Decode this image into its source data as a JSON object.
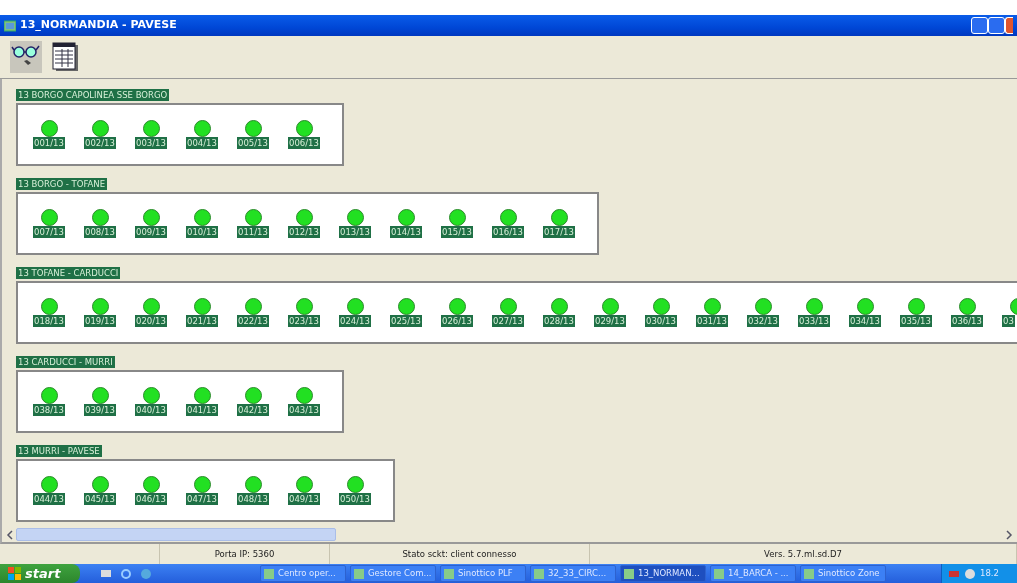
{
  "window": {
    "title": "13_NORMANDIA - PAVESE"
  },
  "groups": [
    {
      "name": "13 BORGO CAPOLINEA SSE BORGO",
      "devices": [
        {
          "label": "001/13",
          "active": true
        },
        {
          "label": "002/13",
          "active": true
        },
        {
          "label": "003/13",
          "active": true
        },
        {
          "label": "004/13",
          "active": true
        },
        {
          "label": "005/13",
          "active": true
        },
        {
          "label": "006/13",
          "active": true
        }
      ]
    },
    {
      "name": "13 BORGO - TOFANE",
      "devices": [
        {
          "label": "007/13",
          "active": true
        },
        {
          "label": "008/13",
          "active": true
        },
        {
          "label": "009/13",
          "active": true
        },
        {
          "label": "010/13",
          "active": true
        },
        {
          "label": "011/13",
          "active": true
        },
        {
          "label": "012/13",
          "active": true
        },
        {
          "label": "013/13",
          "active": true
        },
        {
          "label": "014/13",
          "active": true
        },
        {
          "label": "015/13",
          "active": true
        },
        {
          "label": "016/13",
          "active": true
        },
        {
          "label": "017/13",
          "active": true
        }
      ]
    },
    {
      "name": "13 TOFANE - CARDUCCI",
      "devices": [
        {
          "label": "018/13",
          "active": true
        },
        {
          "label": "019/13",
          "active": true
        },
        {
          "label": "020/13",
          "active": true
        },
        {
          "label": "021/13",
          "active": true
        },
        {
          "label": "022/13",
          "active": true
        },
        {
          "label": "023/13",
          "active": true
        },
        {
          "label": "024/13",
          "active": true
        },
        {
          "label": "025/13",
          "active": true
        },
        {
          "label": "026/13",
          "active": true
        },
        {
          "label": "027/13",
          "active": true
        },
        {
          "label": "028/13",
          "active": true
        },
        {
          "label": "029/13",
          "active": true
        },
        {
          "label": "030/13",
          "active": true
        },
        {
          "label": "031/13",
          "active": true
        },
        {
          "label": "032/13",
          "active": true
        },
        {
          "label": "033/13",
          "active": true
        },
        {
          "label": "034/13",
          "active": true
        },
        {
          "label": "035/13",
          "active": true
        },
        {
          "label": "036/13",
          "active": true
        },
        {
          "label": "03",
          "active": true
        }
      ]
    },
    {
      "name": "13 CARDUCCI - MURRI",
      "devices": [
        {
          "label": "038/13",
          "active": true
        },
        {
          "label": "039/13",
          "active": true
        },
        {
          "label": "040/13",
          "active": true
        },
        {
          "label": "041/13",
          "active": true
        },
        {
          "label": "042/13",
          "active": true
        },
        {
          "label": "043/13",
          "active": true
        }
      ]
    },
    {
      "name": "13 MURRI - PAVESE",
      "devices": [
        {
          "label": "044/13",
          "active": true
        },
        {
          "label": "045/13",
          "active": true
        },
        {
          "label": "046/13",
          "active": true
        },
        {
          "label": "047/13",
          "active": true
        },
        {
          "label": "048/13",
          "active": true
        },
        {
          "label": "049/13",
          "active": true
        },
        {
          "label": "050/13",
          "active": true
        }
      ]
    }
  ],
  "status_bar": [
    "Porta IP: 5360",
    "Stato sckt: client connesso",
    "Vers. 5.7.ml.sd.D7"
  ],
  "taskbar": {
    "start": "start",
    "items": [
      {
        "label": "Centro oper...",
        "selected": false
      },
      {
        "label": "Gestore Com...",
        "selected": false
      },
      {
        "label": "Sinottico PLF",
        "selected": false
      },
      {
        "label": "32_33_CIRC...",
        "selected": false
      },
      {
        "label": "13_NORMAN...",
        "selected": true
      },
      {
        "label": "14_BARCA - ...",
        "selected": false
      },
      {
        "label": "Sinottico Zone",
        "selected": false
      }
    ],
    "clock": "18.2"
  }
}
